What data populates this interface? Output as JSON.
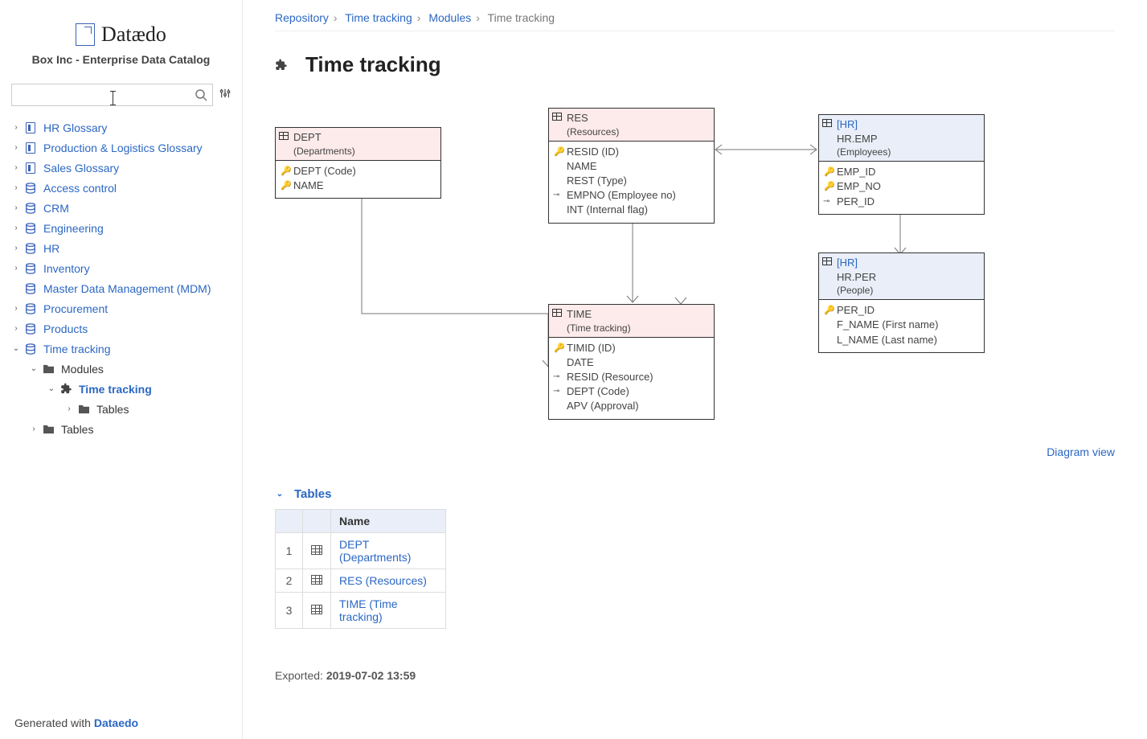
{
  "brand": "Datædo",
  "subtitle": "Box Inc - Enterprise Data Catalog",
  "footer": {
    "prefix": "Generated with ",
    "brand": "Dataedo"
  },
  "breadcrumb": {
    "a": "Repository",
    "b": "Time tracking",
    "c": "Modules",
    "d": "Time tracking"
  },
  "page_title": "Time tracking",
  "diagram_link": "Diagram view",
  "tables_header": "Tables",
  "exported_prefix": "Exported: ",
  "exported_value": "2019-07-02 13:59",
  "table_col_name": "Name",
  "tree": {
    "i0": "HR Glossary",
    "i1": "Production & Logistics Glossary",
    "i2": "Sales Glossary",
    "i3": "Access control",
    "i4": "CRM",
    "i5": "Engineering",
    "i6": "HR",
    "i7": "Inventory",
    "i8": "Master Data Management (MDM)",
    "i9": "Procurement",
    "i10": "Products",
    "i11": "Time tracking",
    "i11a": "Modules",
    "i11a1": "Time tracking",
    "i11a1a": "Tables",
    "i11b": "Tables"
  },
  "erd": {
    "dept": {
      "name": "DEPT",
      "label": "(Departments)",
      "c0": "DEPT (Code)",
      "c1": "NAME"
    },
    "res": {
      "name": "RES",
      "label": "(Resources)",
      "c0": "RESID (ID)",
      "c1": "NAME",
      "c2": "REST (Type)",
      "c3": "EMPNO (Employee no)",
      "c4": "INT (Internal flag)"
    },
    "time": {
      "name": "TIME",
      "label": "(Time tracking)",
      "c0": "TIMID (ID)",
      "c1": "DATE",
      "c2": "RESID (Resource)",
      "c3": "DEPT (Code)",
      "c4": "APV (Approval)"
    },
    "emp": {
      "tag": "[HR]",
      "name": "HR.EMP",
      "label": "(Employees)",
      "c0": "EMP_ID",
      "c1": "EMP_NO",
      "c2": "PER_ID"
    },
    "per": {
      "tag": "[HR]",
      "name": "HR.PER",
      "label": "(People)",
      "c0": "PER_ID",
      "c1": "F_NAME (First name)",
      "c2": "L_NAME (Last name)"
    }
  },
  "tables_list": {
    "r1": {
      "n": "1",
      "name": "DEPT (Departments)"
    },
    "r2": {
      "n": "2",
      "name": "RES (Resources)"
    },
    "r3": {
      "n": "3",
      "name": "TIME (Time tracking)"
    }
  }
}
